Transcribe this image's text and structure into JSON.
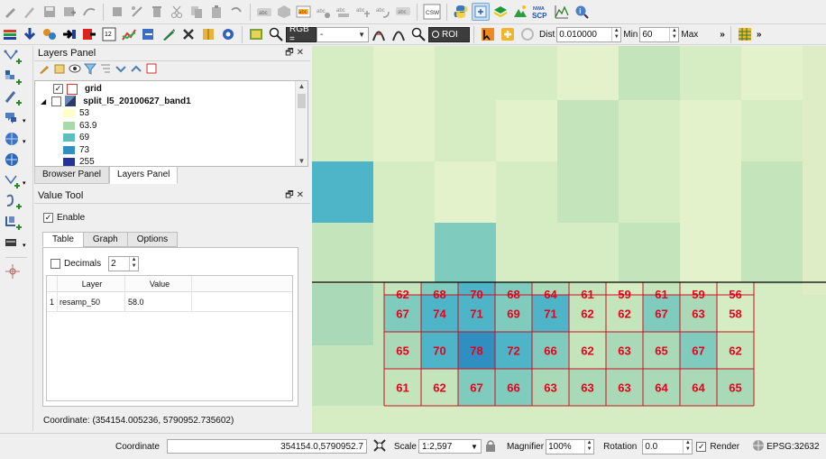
{
  "toolbar2": {
    "rgb_label": "RGB =",
    "rgb_value": "-",
    "roi_label": "ROI",
    "dist_label": "Dist",
    "dist_value": "0.010000",
    "min_label": "Min",
    "min_value": "60",
    "max_label": "Max",
    "overflow": "»"
  },
  "toolbar1": {
    "csw_label": "CSW",
    "nwa_label": "NWA",
    "scp_label": "SCP"
  },
  "layers_panel": {
    "title": "Layers Panel",
    "layers": [
      {
        "name": "grid",
        "checked": true
      },
      {
        "name": "split_l5_20100627_band1",
        "checked": false
      }
    ],
    "legend": [
      {
        "label": "53",
        "color": "#ffffc7"
      },
      {
        "label": "63.9",
        "color": "#a6dba9"
      },
      {
        "label": "69",
        "color": "#5bbfc0"
      },
      {
        "label": "73",
        "color": "#2f91c2"
      },
      {
        "label": "255",
        "color": "#253494"
      }
    ],
    "tabs": [
      "Browser Panel",
      "Layers Panel"
    ]
  },
  "value_tool": {
    "title": "Value Tool",
    "enable_label": "Enable",
    "enable_check": "✓",
    "tabs": [
      "Table",
      "Graph",
      "Options"
    ],
    "decimals_label": "Decimals",
    "decimals_value": "2",
    "columns": [
      "Layer",
      "Value"
    ],
    "rows": [
      {
        "index": "1",
        "layer": "resamp_50",
        "value": "58.0"
      }
    ],
    "coordinate": "Coordinate: (354154.005236, 5790952.735602)"
  },
  "map": {
    "rows": [
      [
        null,
        null,
        null,
        null,
        null,
        null,
        null,
        null,
        null,
        null
      ],
      [
        "67",
        "74",
        "71",
        "69",
        "71",
        "62",
        "62",
        "67",
        "63",
        "58"
      ],
      [
        "65",
        "70",
        "78",
        "72",
        "66",
        "62",
        "63",
        "65",
        "67",
        "62"
      ],
      [
        "61",
        "62",
        "67",
        "66",
        "63",
        "63",
        "63",
        "64",
        "64",
        "65"
      ]
    ],
    "partial_row": [
      "62",
      "68",
      "70",
      "68",
      "64",
      "61",
      "59",
      "61",
      "59",
      "56"
    ],
    "label_color": "#e8001c"
  },
  "status": {
    "coordinate_label": "Coordinate",
    "coordinate_value": "354154.0,5790952.7",
    "scale_label": "Scale",
    "scale_value": "1:2,597",
    "magnifier_label": "Magnifier",
    "magnifier_value": "100%",
    "rotation_label": "Rotation",
    "rotation_value": "0.0",
    "render_label": "Render",
    "render_check": "✓",
    "crs": "EPSG:32632"
  }
}
